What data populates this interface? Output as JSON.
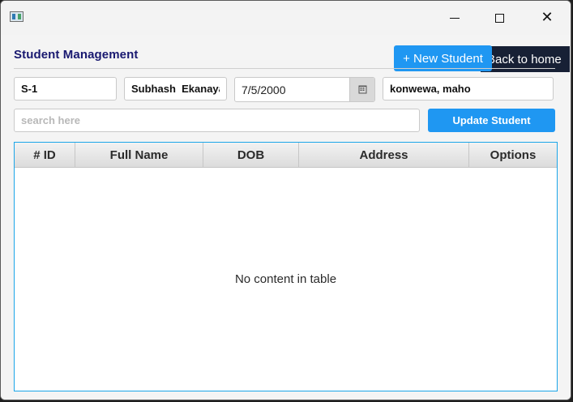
{
  "window": {
    "icon": "app-window-icon",
    "controls": {
      "minimize_icon": "minimize-icon",
      "maximize_icon": "maximize-icon",
      "close_icon": "close-icon",
      "close_glyph": "✕"
    }
  },
  "header": {
    "title": "Student Management",
    "back_label": "Back to home",
    "new_label": "+ New Student"
  },
  "form": {
    "id_value": "S-1",
    "name_value": "Subhash  Ekanayake",
    "dob_value": "7/5/2000",
    "address_value": "konwewa, maho",
    "calendar_icon": "calendar-icon"
  },
  "search": {
    "placeholder": "search here",
    "value": ""
  },
  "actions": {
    "update_label": "Update Student"
  },
  "table": {
    "columns": [
      "# ID",
      "Full Name",
      "DOB",
      "Address",
      "Options"
    ],
    "empty_message": "No content in table",
    "border_color": "#1ba5e8"
  },
  "colors": {
    "primary": "#1f97f2",
    "dark_button": "#172035",
    "title_color": "#191970"
  }
}
